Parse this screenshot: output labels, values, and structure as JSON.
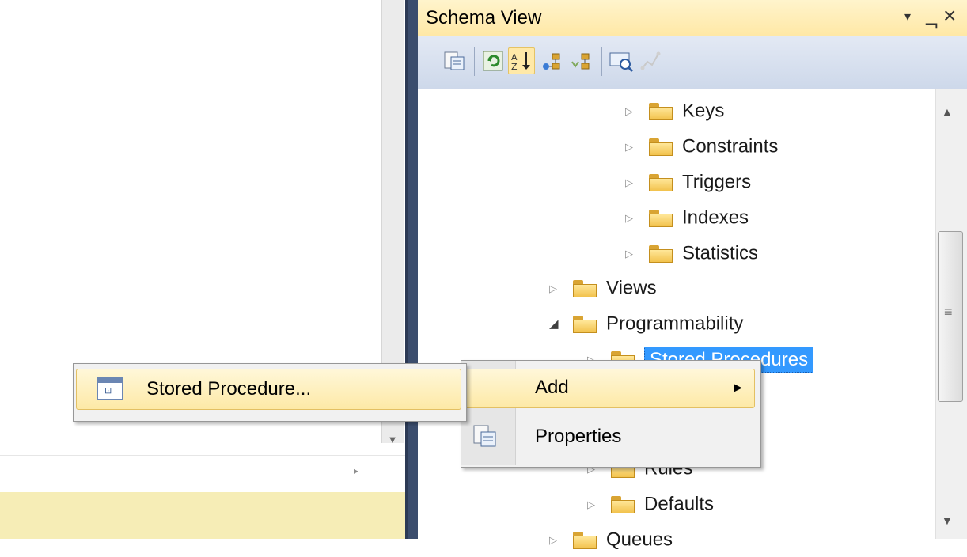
{
  "panel": {
    "title": "Schema View",
    "window_buttons": {
      "dropdown": "▾",
      "pin": "ᆨ",
      "close": "×"
    }
  },
  "toolbar": {
    "buttons": [
      {
        "icon": "properties-icon"
      },
      {
        "icon": "refresh-icon"
      },
      {
        "icon": "sort-alphabetical-icon",
        "active": true
      },
      {
        "icon": "schema-compare-icon"
      },
      {
        "icon": "schema-filter-icon"
      },
      {
        "icon": "find-icon"
      },
      {
        "icon": "dependency-icon",
        "disabled": true
      }
    ]
  },
  "tree": {
    "items": [
      {
        "label": "Keys",
        "expanded": false,
        "level": 3
      },
      {
        "label": "Constraints",
        "expanded": false,
        "level": 3
      },
      {
        "label": "Triggers",
        "expanded": false,
        "level": 3
      },
      {
        "label": "Indexes",
        "expanded": false,
        "level": 3
      },
      {
        "label": "Statistics",
        "expanded": false,
        "level": 3
      },
      {
        "label": "Views",
        "expanded": false,
        "level": 2
      },
      {
        "label": "Programmability",
        "expanded": true,
        "level": 2
      },
      {
        "label": "Stored Procedures",
        "expanded": false,
        "level": 3,
        "selected": true
      },
      {
        "label": "Rules",
        "expanded": false,
        "level": 3
      },
      {
        "label": "Defaults",
        "expanded": false,
        "level": 3
      },
      {
        "label": "Queues",
        "expanded": false,
        "level": 2
      }
    ]
  },
  "context_menu": {
    "items": [
      {
        "label": "Add",
        "has_submenu": true,
        "highlighted": true,
        "arrow": "▶"
      },
      {
        "label": "Properties",
        "icon": "properties-icon"
      }
    ]
  },
  "submenu": {
    "items": [
      {
        "label": "Stored Procedure...",
        "icon": "stored-procedure-icon",
        "highlighted": true,
        "icon_glyph": "⊡"
      }
    ]
  },
  "glyphs": {
    "collapsed": "▷",
    "expanded": "◢",
    "scroll_up": "▲",
    "scroll_down": "▼",
    "scroll_grip": "≡",
    "row_arrow": "▸"
  },
  "colors": {
    "title_bar": "#ffe8a6",
    "toolbar": "#cdd8ea",
    "splitter": "#3b4d6d",
    "selection": "#3399ff",
    "menu_highlight": "#fde9a6",
    "left_highlight": "#f6edb6"
  }
}
